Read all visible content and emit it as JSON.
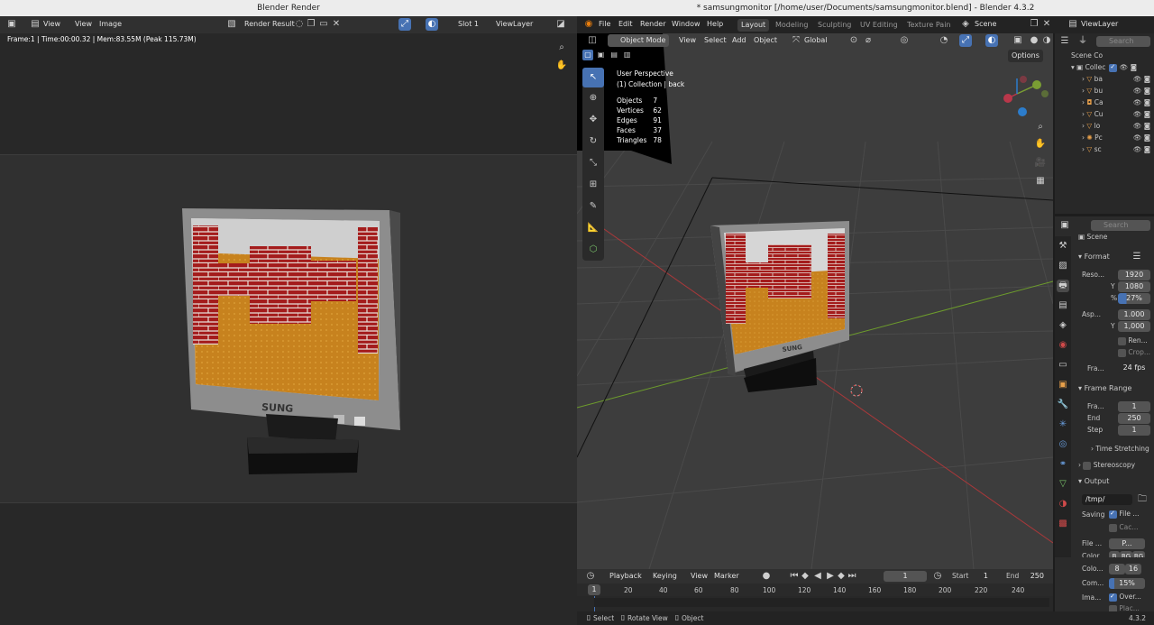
{
  "render_window": {
    "title": "Blender Render",
    "menu": [
      "View",
      "View",
      "Image"
    ],
    "render_result": "Render Result",
    "slot": "Slot 1",
    "view_layer": "ViewLayer",
    "stats": "Frame:1 | Time:00:00.32 | Mem:83.55M (Peak 115.73M)",
    "monitor_brand": "SUNG"
  },
  "main_window": {
    "title": "* samsungmonitor [/home/user/Documents/samsungmonitor.blend] - Blender 4.3.2",
    "menus": [
      "File",
      "Edit",
      "Render",
      "Window",
      "Help"
    ],
    "workspaces": [
      "Layout",
      "Modeling",
      "Sculpting",
      "UV Editing",
      "Texture Pain"
    ],
    "scene": "Scene",
    "view_layer": "ViewLayer"
  },
  "viewport": {
    "mode": "Object Mode",
    "menus": [
      "View",
      "Select",
      "Add",
      "Object"
    ],
    "orientation": "Global",
    "options": "Options",
    "perspective": "User Perspective",
    "collection": "(1) Collection | back",
    "stats": [
      {
        "k": "Objects",
        "v": "7"
      },
      {
        "k": "Vertices",
        "v": "62"
      },
      {
        "k": "Edges",
        "v": "91"
      },
      {
        "k": "Faces",
        "v": "37"
      },
      {
        "k": "Triangles",
        "v": "78"
      }
    ],
    "monitor_brand": "SUNG"
  },
  "outliner": {
    "root": "Scene Co",
    "collection": "Collec",
    "items": [
      "ba",
      "bu",
      "Ca",
      "Cu",
      "lo",
      "Pc",
      "sc"
    ],
    "search_placeholder": "Search"
  },
  "properties": {
    "search_placeholder": "Search",
    "scene": "Scene",
    "format_label": "Format",
    "res_label": "Reso...",
    "res_x": "1920",
    "y_label": "Y",
    "res_y": "1080",
    "pct_label": "%",
    "pct": "27%",
    "asp_label": "Asp...",
    "asp_x": "1.000",
    "asp_y_label": "Y",
    "asp_y": "1,000",
    "render_region": "Ren...",
    "crop": "Crop...",
    "fr_label": "Fra...",
    "fps": "24 fps",
    "frame_range": "Frame Range",
    "frame_start_label": "Fra...",
    "frame_start": "1",
    "end_label": "End",
    "end": "250",
    "step_label": "Step",
    "step": "1",
    "time_stretching": "Time Stretching",
    "stereoscopy": "Stereoscopy",
    "output": "Output",
    "path": "/tmp/",
    "saving": "Saving",
    "file_ext": "File ...",
    "cache": "Cac...",
    "file_format_label": "File ...",
    "file_format": "P...",
    "color_label": "Color",
    "color_opts": [
      "B",
      "RG",
      "RG"
    ],
    "depth_label": "Colo...",
    "depth_opts": [
      "8",
      "16"
    ],
    "comp_label": "Com...",
    "comp": "15%",
    "image_label": "Ima...",
    "overwrite": "Over...",
    "placeholders": "Plac..."
  },
  "timeline": {
    "playback": "Playback",
    "keying": "Keying",
    "view": "View",
    "marker": "Marker",
    "current": "1",
    "start_label": "Start",
    "start": "1",
    "end_label": "End",
    "end": "250",
    "ticks": [
      "1",
      "20",
      "40",
      "60",
      "80",
      "100",
      "120",
      "140",
      "160",
      "180",
      "200",
      "220",
      "240"
    ]
  },
  "statusbar": {
    "select": "Select",
    "rotate": "Rotate View",
    "object": "Object",
    "version": "4.3.2"
  }
}
